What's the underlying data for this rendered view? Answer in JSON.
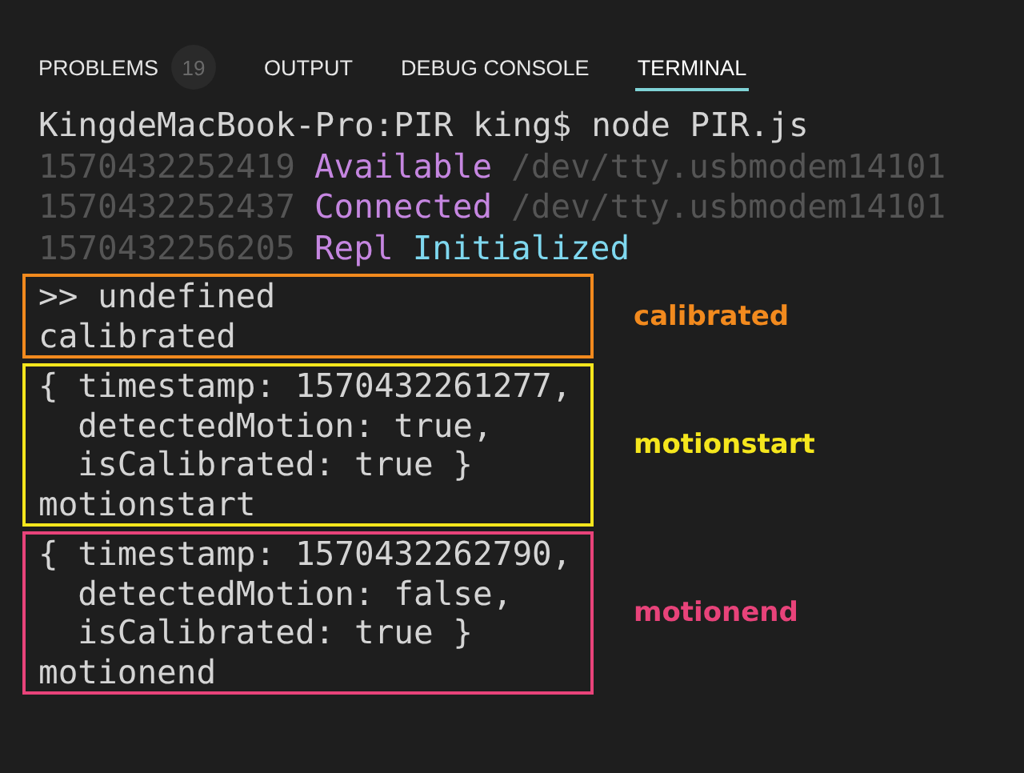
{
  "tabs": [
    {
      "label": "PROBLEMS",
      "badge": "19",
      "selected": false
    },
    {
      "label": "OUTPUT",
      "selected": false
    },
    {
      "label": "DEBUG CONSOLE",
      "selected": false
    },
    {
      "label": "TERMINAL",
      "selected": true
    }
  ],
  "terminal": {
    "prompt": "KingdeMacBook-Pro:PIR king$ node PIR.js",
    "log": [
      [
        {
          "text": "1570432252419",
          "color": "#555555"
        },
        {
          "text": "Available",
          "color": "#c586e0"
        },
        {
          "text": "/dev/tty.usbmodem14101",
          "color": "#555555"
        }
      ],
      [
        {
          "text": "1570432252437",
          "color": "#555555"
        },
        {
          "text": "Connected",
          "color": "#c586e0"
        },
        {
          "text": "/dev/tty.usbmodem14101",
          "color": "#555555"
        }
      ],
      [
        {
          "text": "1570432256205",
          "color": "#555555"
        },
        {
          "text": "Repl",
          "color": "#c586e0"
        },
        {
          "text": "Initialized",
          "color": "#7fd8ef"
        }
      ]
    ],
    "blocks": [
      {
        "lines": [
          ">> undefined",
          "calibrated"
        ],
        "note": "calibrated",
        "color": "#f28a1e"
      },
      {
        "lines": [
          "{ timestamp: 1570432261277,",
          "  detectedMotion: true,",
          "  isCalibrated: true }",
          "motionstart"
        ],
        "note": "motionstart",
        "color": "#f5e61d"
      },
      {
        "lines": [
          "{ timestamp: 1570432262790,",
          "  detectedMotion: false,",
          "  isCalibrated: true }",
          "motionend"
        ],
        "note": "motionend",
        "color": "#e8437a"
      }
    ]
  }
}
